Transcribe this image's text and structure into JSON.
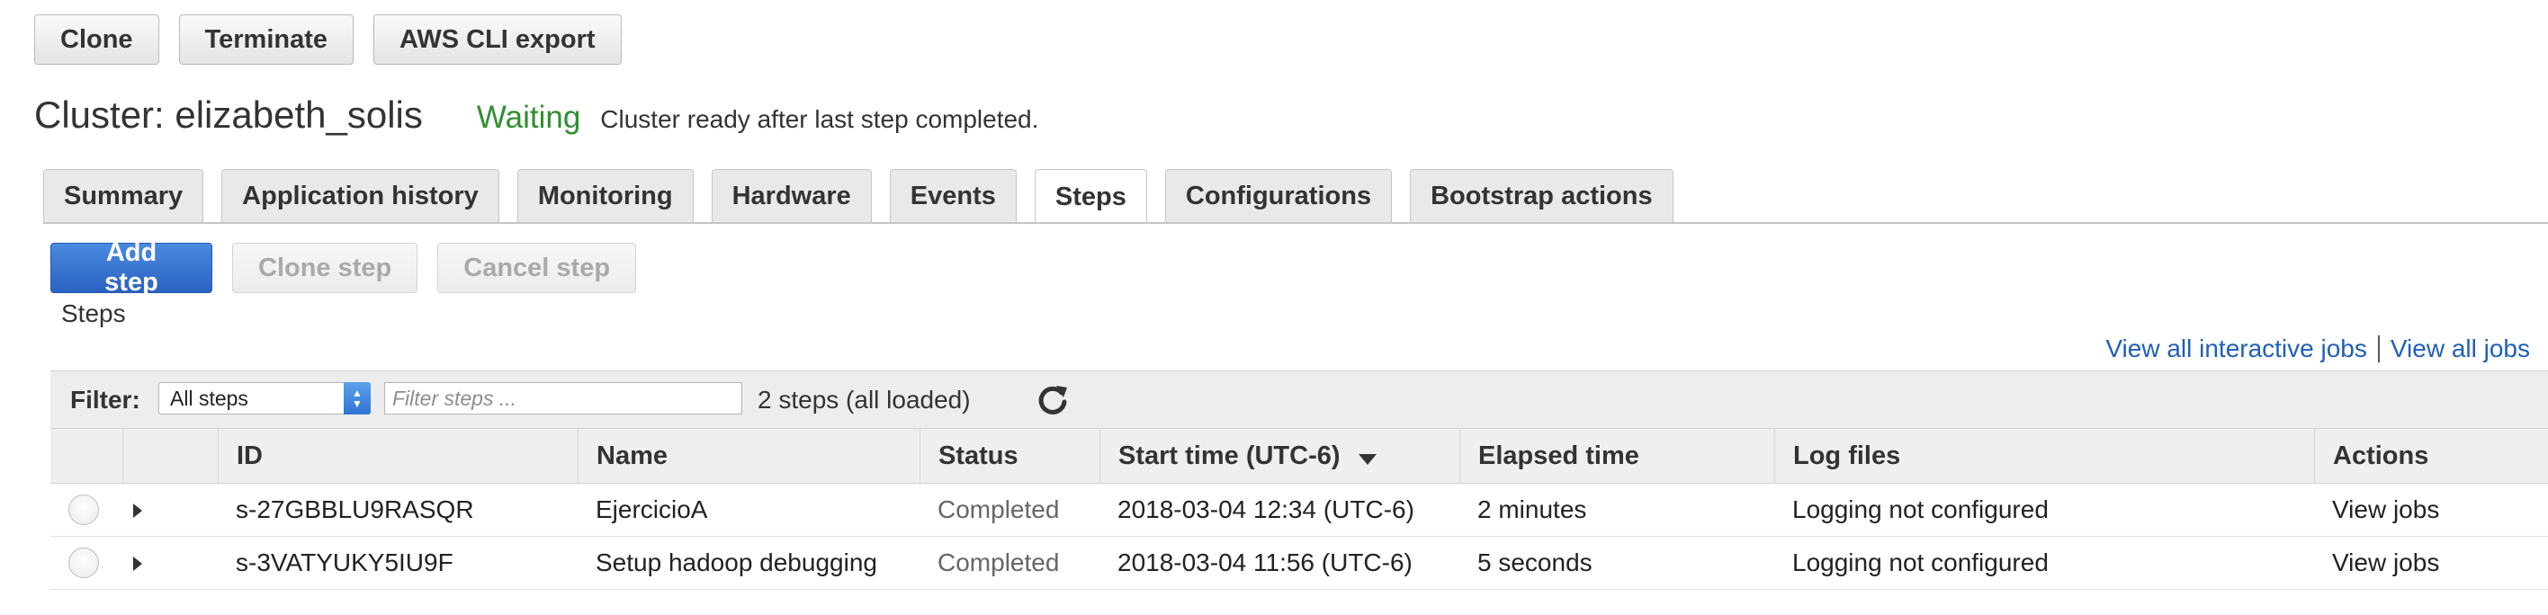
{
  "top_actions": {
    "clone": "Clone",
    "terminate": "Terminate",
    "aws_cli_export": "AWS CLI export"
  },
  "cluster": {
    "title": "Cluster: elizabeth_solis",
    "status": "Waiting",
    "status_message": "Cluster ready after last step completed.",
    "status_color": "#2f8f2f"
  },
  "tabs": [
    {
      "label": "Summary"
    },
    {
      "label": "Application history"
    },
    {
      "label": "Monitoring"
    },
    {
      "label": "Hardware"
    },
    {
      "label": "Events"
    },
    {
      "label": "Steps",
      "active": true
    },
    {
      "label": "Configurations"
    },
    {
      "label": "Bootstrap actions"
    }
  ],
  "step_actions": {
    "add": "Add step",
    "clone": "Clone step",
    "cancel": "Cancel step"
  },
  "steps_section_label": "Steps",
  "links": {
    "interactive_jobs": "View all interactive jobs",
    "all_jobs": "View all jobs"
  },
  "filter": {
    "label": "Filter:",
    "select_value": "All steps",
    "input_placeholder": "Filter steps ...",
    "count_text": "2 steps (all loaded)"
  },
  "table": {
    "headers": {
      "id": "ID",
      "name": "Name",
      "status": "Status",
      "start_time": "Start time (UTC-6)",
      "elapsed": "Elapsed time",
      "log_files": "Log files",
      "actions": "Actions"
    },
    "rows": [
      {
        "id": "s-27GBBLU9RASQR",
        "name": "EjercicioA",
        "status": "Completed",
        "start_time": "2018-03-04 12:34 (UTC-6)",
        "elapsed": "2 minutes",
        "log_files": "Logging not configured",
        "action": "View jobs"
      },
      {
        "id": "s-3VATYUKY5IU9F",
        "name": "Setup hadoop debugging",
        "status": "Completed",
        "start_time": "2018-03-04 11:56 (UTC-6)",
        "elapsed": "5 seconds",
        "log_files": "Logging not configured",
        "action": "View jobs"
      }
    ]
  },
  "colors": {
    "link": "#1f5fb8",
    "primary_button": "#2a62c1"
  }
}
